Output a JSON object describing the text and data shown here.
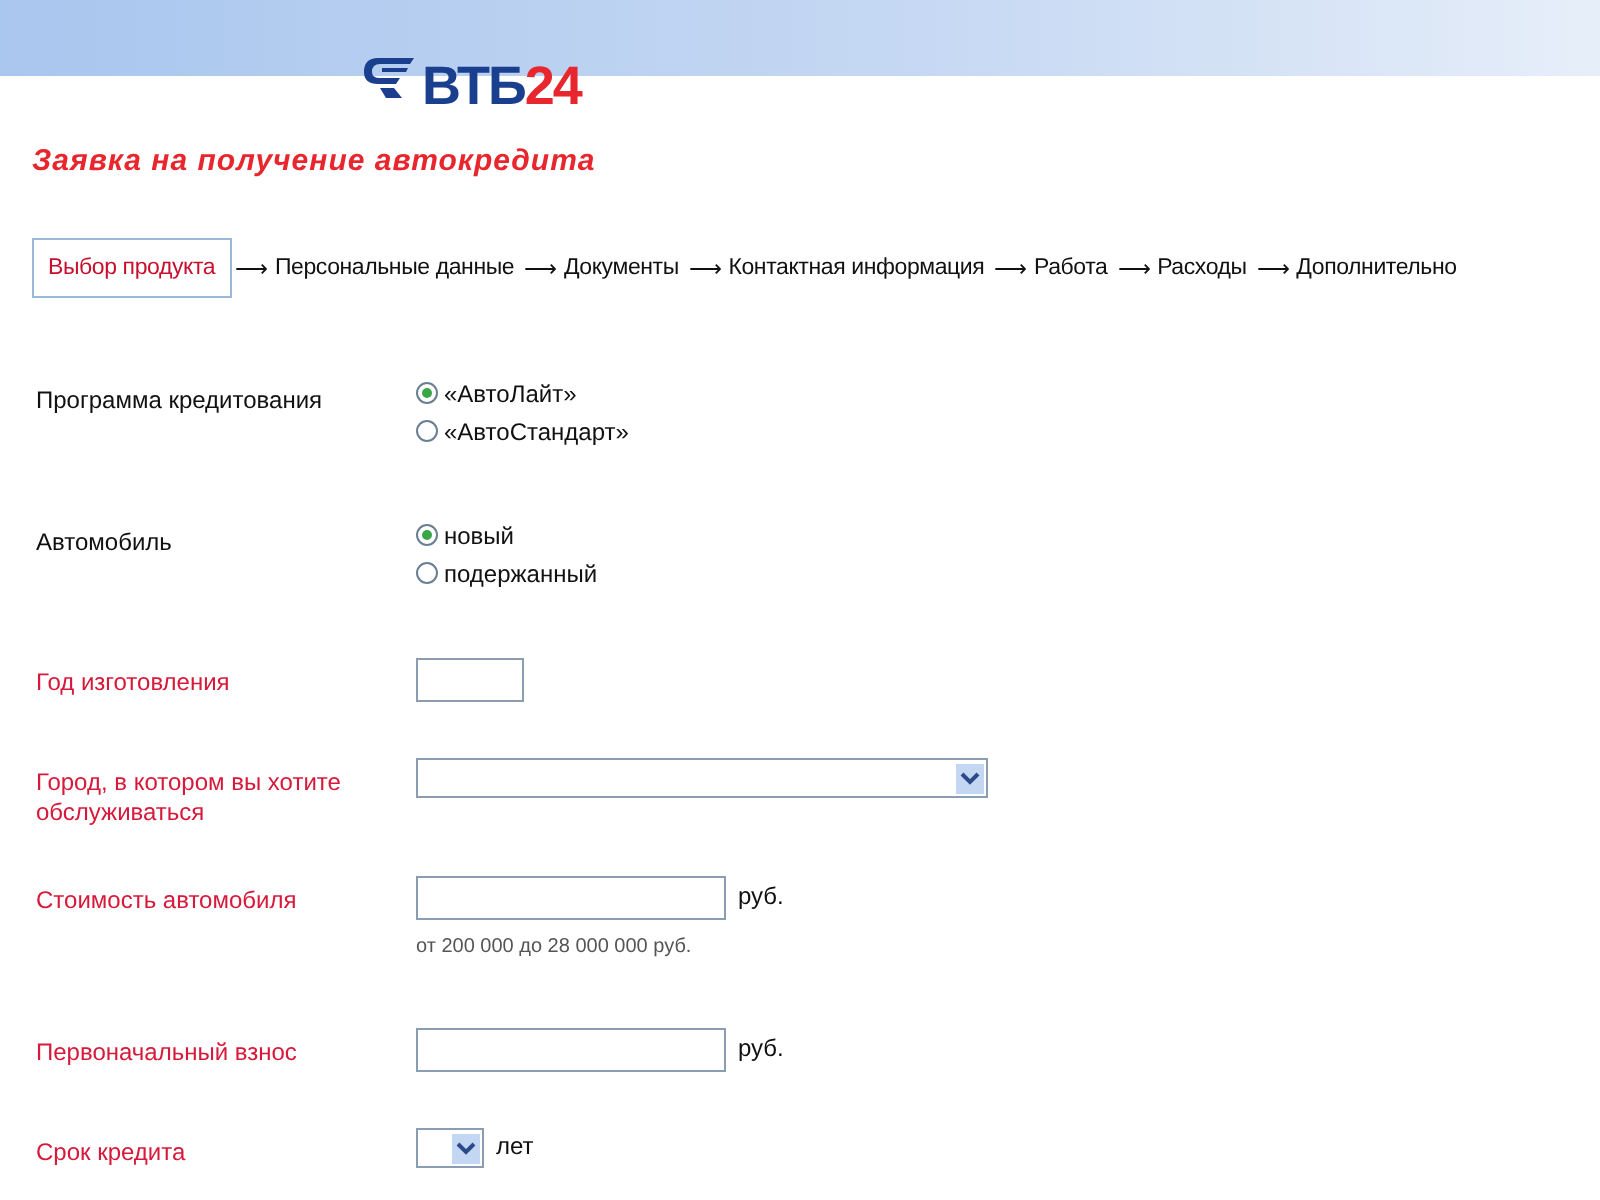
{
  "logo": {
    "letters": "ВТБ",
    "digits": "24"
  },
  "title": "Заявка на получение автокредита",
  "steps": [
    {
      "label": "Выбор продукта",
      "selected": true
    },
    {
      "arrow": "⟶",
      "label": "Персональные данные",
      "selected": false
    },
    {
      "arrow": "⟶",
      "label": "Документы",
      "selected": false
    },
    {
      "arrow": "⟶",
      "label": "Контактная информация",
      "selected": false
    },
    {
      "arrow": "⟶",
      "label": "Работа",
      "selected": false
    },
    {
      "arrow": "⟶",
      "label": "Расходы",
      "selected": false
    },
    {
      "arrow": "⟶",
      "label": "Дополнительно",
      "selected": false
    }
  ],
  "fields": [
    {
      "kind": "radio",
      "label": "Программа кредитования",
      "required": false,
      "options": [
        {
          "label": "«АвтоЛайт»",
          "selected": true
        },
        {
          "label": "«АвтоСтандарт»",
          "selected": false
        }
      ]
    },
    {
      "kind": "radio",
      "label": "Автомобиль",
      "required": false,
      "options": [
        {
          "label": "новый",
          "selected": true
        },
        {
          "label": "подержанный",
          "selected": false
        }
      ]
    },
    {
      "kind": "text",
      "label": "Год изготовления",
      "required": true
    },
    {
      "kind": "select",
      "label": "Город, в котором вы хотите обслуживаться",
      "required": true
    },
    {
      "kind": "text",
      "label": "Стоимость автомобиля",
      "required": true,
      "unit": "руб.",
      "hint": "от 200 000 до 28 000 000 руб."
    },
    {
      "kind": "text",
      "label": "Первоначальный взнос",
      "required": true,
      "unit": "руб."
    },
    {
      "kind": "select",
      "label": "Срок кредита",
      "required": true,
      "unit": "лет"
    }
  ]
}
